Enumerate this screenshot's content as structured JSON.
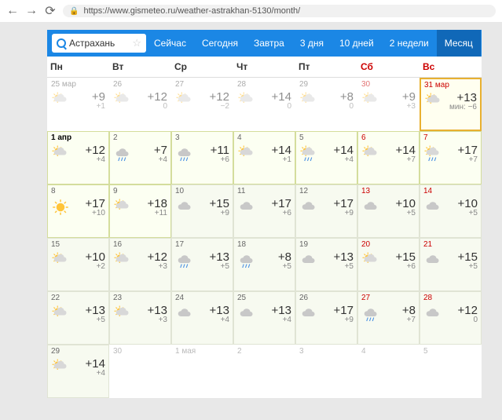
{
  "browser": {
    "url": "https://www.gismeteo.ru/weather-astrakhan-5130/month/"
  },
  "search": {
    "city": "Астрахань"
  },
  "tabs": [
    "Сейчас",
    "Сегодня",
    "Завтра",
    "3 дня",
    "10 дней",
    "2 недели",
    "Месяц"
  ],
  "headers": [
    "Пн",
    "Вт",
    "Ср",
    "Чт",
    "Пт",
    "Сб",
    "Вс"
  ],
  "cells": [
    {
      "date": "25 мар",
      "high": "+9",
      "low": "+1",
      "style": "past",
      "icon": "pc"
    },
    {
      "date": "26",
      "high": "+12",
      "low": "0",
      "style": "past",
      "icon": "pc"
    },
    {
      "date": "27",
      "high": "+12",
      "low": "−2",
      "style": "past",
      "icon": "pc"
    },
    {
      "date": "28",
      "high": "+14",
      "low": "0",
      "style": "past",
      "icon": "pc"
    },
    {
      "date": "29",
      "high": "+8",
      "low": "0",
      "style": "past",
      "icon": "pc"
    },
    {
      "date": "30",
      "high": "+9",
      "low": "+3",
      "style": "past",
      "weekend": true,
      "icon": "pc"
    },
    {
      "date": "31 мар",
      "high": "+13",
      "low": "мин: −6",
      "style": "today",
      "weekend": true,
      "icon": "ps"
    },
    {
      "date": "1 апр",
      "high": "+12",
      "low": "+4",
      "style": "hl1",
      "bold": true,
      "icon": "ps"
    },
    {
      "date": "2",
      "high": "+7",
      "low": "+4",
      "style": "hl1",
      "icon": "rc"
    },
    {
      "date": "3",
      "high": "+11",
      "low": "+6",
      "style": "hl1",
      "icon": "rc"
    },
    {
      "date": "4",
      "high": "+14",
      "low": "+1",
      "style": "hl1",
      "icon": "ps"
    },
    {
      "date": "5",
      "high": "+14",
      "low": "+4",
      "style": "hl1",
      "icon": "rps"
    },
    {
      "date": "6",
      "high": "+14",
      "low": "+7",
      "style": "hl1",
      "weekend": true,
      "icon": "ps"
    },
    {
      "date": "7",
      "high": "+17",
      "low": "+7",
      "style": "hl1",
      "weekend": true,
      "icon": "rps"
    },
    {
      "date": "8",
      "high": "+17",
      "low": "+10",
      "style": "hl1",
      "icon": "sun"
    },
    {
      "date": "9",
      "high": "+18",
      "low": "+11",
      "style": "hl1",
      "icon": "ps"
    },
    {
      "date": "10",
      "high": "+15",
      "low": "+9",
      "style": "hl2",
      "icon": "c"
    },
    {
      "date": "11",
      "high": "+17",
      "low": "+6",
      "style": "hl2",
      "icon": "c"
    },
    {
      "date": "12",
      "high": "+17",
      "low": "+9",
      "style": "hl2",
      "icon": "c"
    },
    {
      "date": "13",
      "high": "+10",
      "low": "+5",
      "style": "hl2",
      "weekend": true,
      "icon": "c"
    },
    {
      "date": "14",
      "high": "+10",
      "low": "+5",
      "style": "hl2",
      "weekend": true,
      "icon": "c"
    },
    {
      "date": "15",
      "high": "+10",
      "low": "+2",
      "style": "hl2",
      "icon": "pc"
    },
    {
      "date": "16",
      "high": "+12",
      "low": "+3",
      "style": "hl2",
      "icon": "pc"
    },
    {
      "date": "17",
      "high": "+13",
      "low": "+5",
      "style": "hl2",
      "icon": "rc"
    },
    {
      "date": "18",
      "high": "+8",
      "low": "+5",
      "style": "hl2",
      "icon": "rc"
    },
    {
      "date": "19",
      "high": "+13",
      "low": "+5",
      "style": "hl2",
      "icon": "c"
    },
    {
      "date": "20",
      "high": "+15",
      "low": "+6",
      "style": "hl2",
      "weekend": true,
      "icon": "pc"
    },
    {
      "date": "21",
      "high": "+15",
      "low": "+5",
      "style": "hl2",
      "weekend": true,
      "icon": "c"
    },
    {
      "date": "22",
      "high": "+13",
      "low": "+5",
      "style": "hl2",
      "icon": "pc"
    },
    {
      "date": "23",
      "high": "+13",
      "low": "+3",
      "style": "hl2",
      "icon": "pc"
    },
    {
      "date": "24",
      "high": "+13",
      "low": "+4",
      "style": "hl2",
      "icon": "c"
    },
    {
      "date": "25",
      "high": "+13",
      "low": "+4",
      "style": "hl2",
      "icon": "c"
    },
    {
      "date": "26",
      "high": "+17",
      "low": "+9",
      "style": "hl2",
      "icon": "c"
    },
    {
      "date": "27",
      "high": "+8",
      "low": "+7",
      "style": "hl2",
      "weekend": true,
      "icon": "rc"
    },
    {
      "date": "28",
      "high": "+12",
      "low": "0",
      "style": "hl2",
      "weekend": true,
      "icon": "c"
    },
    {
      "date": "29",
      "high": "+14",
      "low": "+4",
      "style": "hl2",
      "icon": "pc"
    },
    {
      "date": "30",
      "high": "",
      "low": "",
      "style": "future",
      "icon": ""
    },
    {
      "date": "1 мая",
      "high": "",
      "low": "",
      "style": "future",
      "icon": ""
    },
    {
      "date": "2",
      "high": "",
      "low": "",
      "style": "future",
      "icon": ""
    },
    {
      "date": "3",
      "high": "",
      "low": "",
      "style": "future",
      "icon": ""
    },
    {
      "date": "4",
      "high": "",
      "low": "",
      "style": "future",
      "icon": ""
    },
    {
      "date": "5",
      "high": "",
      "low": "",
      "style": "future",
      "icon": ""
    }
  ]
}
